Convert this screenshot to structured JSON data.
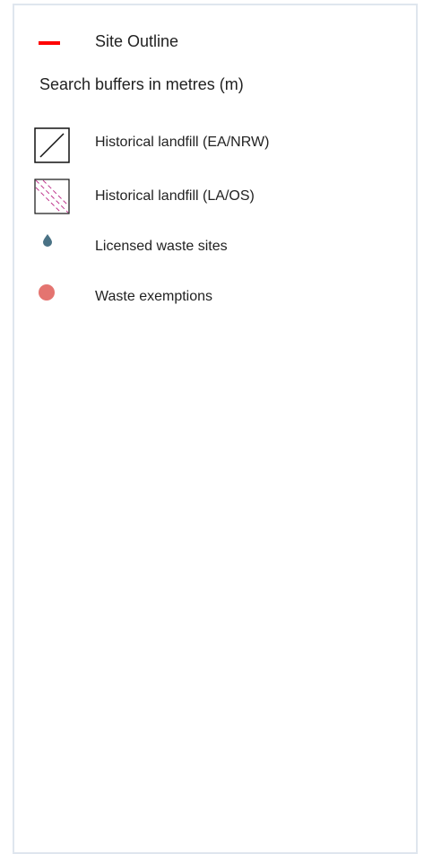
{
  "legend": {
    "site_outline": {
      "label": "Site Outline",
      "color": "#ff0000",
      "icon": "red-line-icon"
    },
    "search_buffers_label": "Search buffers in metres (m)",
    "items": [
      {
        "label": "Historical landfill (EA/NRW)",
        "icon": "diagonal-hatch-square-icon",
        "stroke": "#111111"
      },
      {
        "label": "Historical landfill (LA/OS)",
        "icon": "dashed-hatch-square-icon",
        "stroke": "#111111",
        "hatch_color": "#c0398f"
      },
      {
        "label": "Licensed waste sites",
        "icon": "teardrop-marker-icon",
        "color": "#4a7285"
      },
      {
        "label": "Waste exemptions",
        "icon": "circle-marker-icon",
        "color": "#e47470"
      }
    ]
  }
}
